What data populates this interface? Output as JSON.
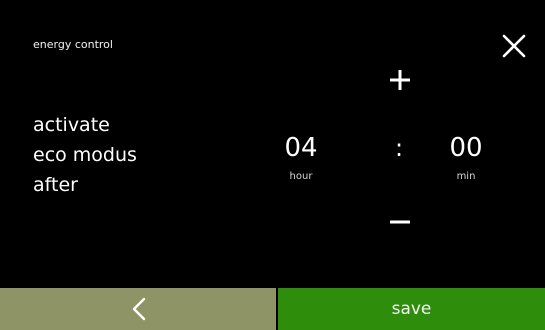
{
  "header": {
    "title": "energy control",
    "close_icon": "close-icon"
  },
  "prompt": {
    "line1": "activate",
    "line2": "eco modus",
    "line3": "after"
  },
  "time": {
    "hour_value": "04",
    "hour_unit": "hour",
    "separator": ":",
    "minute_value": "00",
    "minute_unit": "min",
    "increment_icon": "plus-icon",
    "decrement_icon": "minus-icon"
  },
  "footer": {
    "back_icon": "chevron-left-icon",
    "save_label": "save"
  },
  "colors": {
    "background": "#000000",
    "back_button": "#8f9466",
    "save_button": "#2e8e0c",
    "text": "#ffffff"
  }
}
